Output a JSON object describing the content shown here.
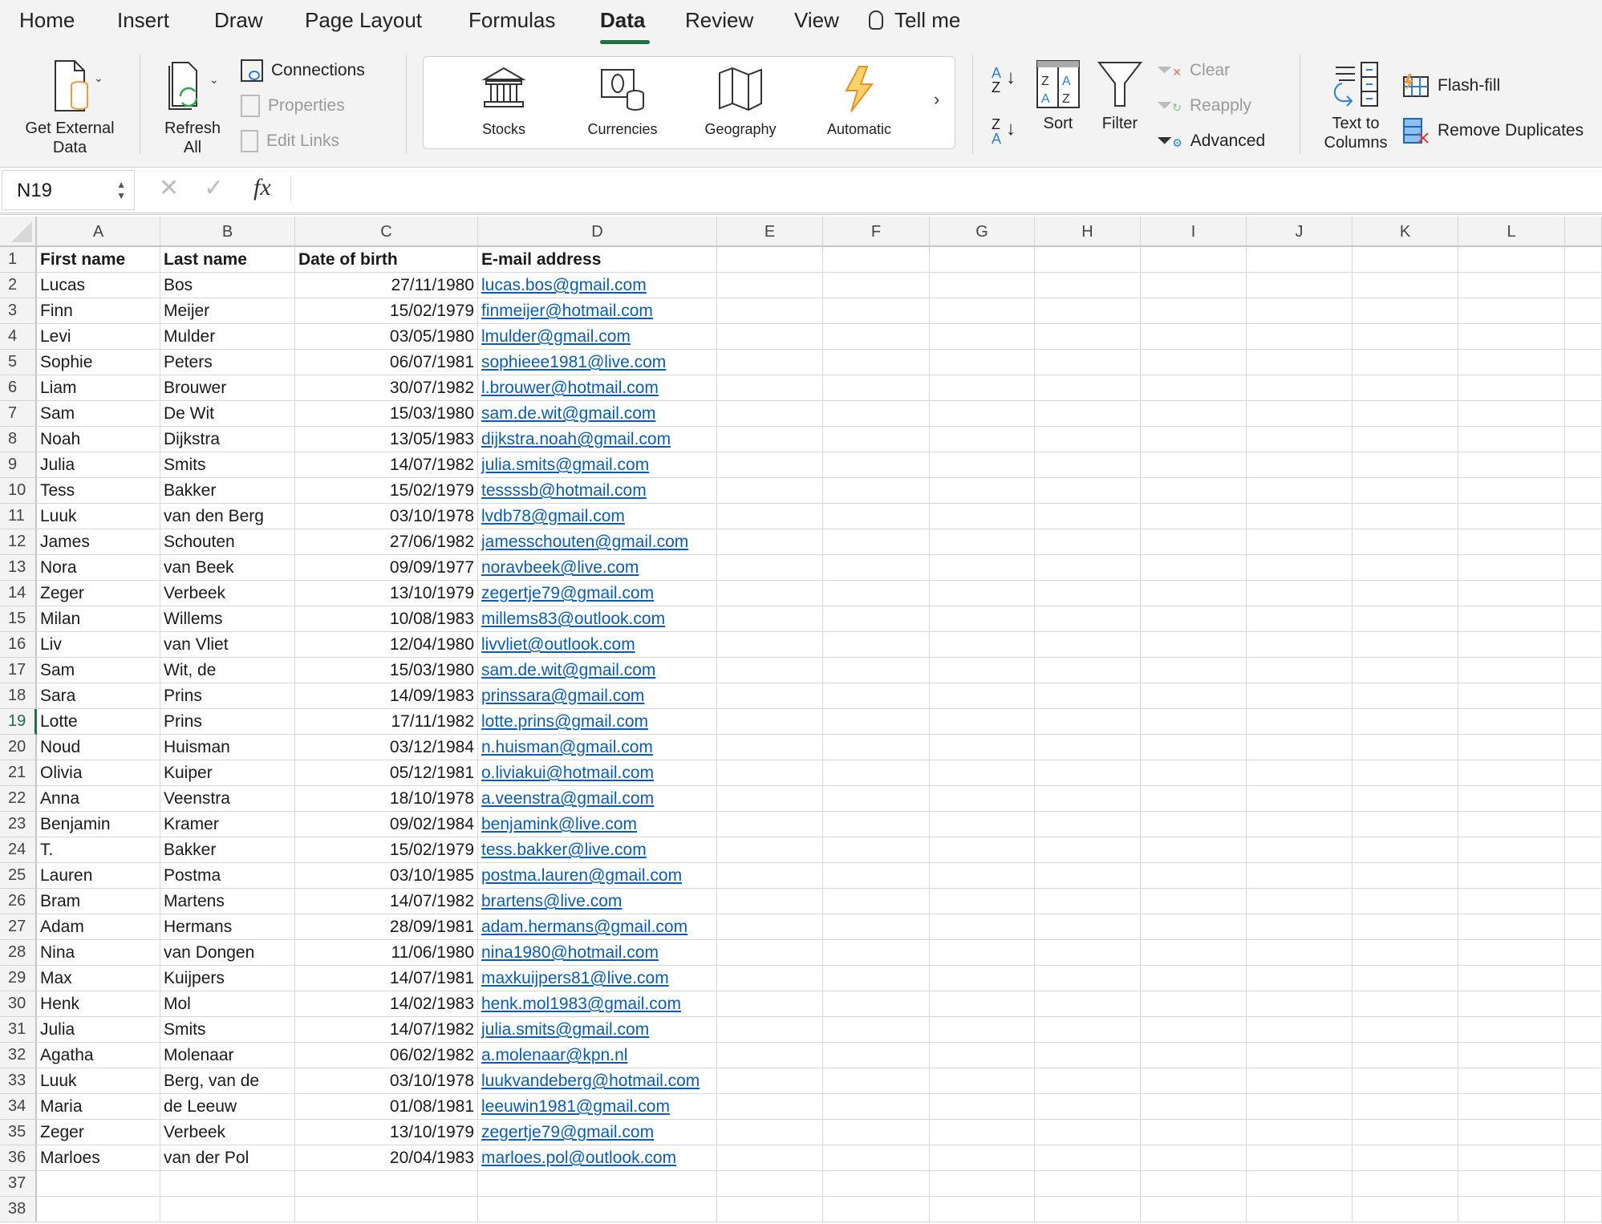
{
  "ribbon": {
    "tabs": [
      {
        "label": "Home",
        "active": false
      },
      {
        "label": "Insert",
        "active": false
      },
      {
        "label": "Draw",
        "active": false
      },
      {
        "label": "Page Layout",
        "active": false
      },
      {
        "label": "Formulas",
        "active": false
      },
      {
        "label": "Data",
        "active": true
      },
      {
        "label": "Review",
        "active": false
      },
      {
        "label": "View",
        "active": false
      },
      {
        "label": "Tell me",
        "active": false
      }
    ],
    "get_external_data": "Get External Data",
    "get_external_data_l1": "Get External",
    "get_external_data_l2": "Data",
    "refresh_l1": "Refresh",
    "refresh_l2": "All",
    "connections": "Connections",
    "properties": "Properties",
    "edit_links": "Edit Links",
    "data_types": [
      "Stocks",
      "Currencies",
      "Geography",
      "Automatic"
    ],
    "sort": "Sort",
    "filter": "Filter",
    "clear": "Clear",
    "reapply": "Reapply",
    "advanced": "Advanced",
    "text_to_columns_l1": "Text to",
    "text_to_columns_l2": "Columns",
    "flash_fill": "Flash-fill",
    "remove_duplicates": "Remove Duplicates"
  },
  "formula_bar": {
    "name_box": "N19",
    "cancel_icon": "✕",
    "enter_icon": "✓",
    "fx_label": "fx",
    "formula_value": ""
  },
  "sheet": {
    "columns": [
      "A",
      "B",
      "C",
      "D",
      "E",
      "F",
      "G",
      "H",
      "I",
      "J",
      "K",
      "L"
    ],
    "selected_row": 19,
    "row_numbers": [
      1,
      2,
      3,
      4,
      5,
      6,
      7,
      8,
      9,
      10,
      11,
      12,
      13,
      14,
      15,
      16,
      17,
      18,
      19,
      20,
      21,
      22,
      23,
      24,
      25,
      26,
      27,
      28,
      29,
      30,
      31,
      32,
      33,
      34,
      35,
      36,
      37,
      38
    ],
    "headers": [
      "First name",
      "Last name",
      "Date of birth",
      "E-mail address"
    ],
    "rows": [
      [
        "Lucas",
        "Bos",
        "27/11/1980",
        "lucas.bos@gmail.com"
      ],
      [
        "Finn",
        "Meijer",
        "15/02/1979",
        "finmeijer@hotmail.com"
      ],
      [
        "Levi",
        "Mulder",
        "03/05/1980",
        "lmulder@gmail.com"
      ],
      [
        "Sophie",
        "Peters",
        "06/07/1981",
        "sophieee1981@live.com"
      ],
      [
        "Liam",
        "Brouwer",
        "30/07/1982",
        "l.brouwer@hotmail.com"
      ],
      [
        "Sam",
        "De Wit",
        "15/03/1980",
        "sam.de.wit@gmail.com"
      ],
      [
        "Noah",
        "Dijkstra",
        "13/05/1983",
        "dijkstra.noah@gmail.com"
      ],
      [
        "Julia",
        "Smits",
        "14/07/1982",
        "julia.smits@gmail.com"
      ],
      [
        "Tess",
        "Bakker",
        "15/02/1979",
        "tessssb@hotmail.com"
      ],
      [
        "Luuk",
        "van den Berg",
        "03/10/1978",
        "lvdb78@gmail.com"
      ],
      [
        "James",
        "Schouten",
        "27/06/1982",
        "jamesschouten@gmail.com"
      ],
      [
        "Nora",
        "van Beek",
        "09/09/1977",
        "noravbeek@live.com"
      ],
      [
        "Zeger",
        "Verbeek",
        "13/10/1979",
        "zegertje79@gmail.com"
      ],
      [
        "Milan",
        "Willems",
        "10/08/1983",
        "millems83@outlook.com"
      ],
      [
        "Liv",
        "van Vliet",
        "12/04/1980",
        "livvliet@outlook.com"
      ],
      [
        "Sam",
        "Wit, de",
        "15/03/1980",
        "sam.de.wit@gmail.com"
      ],
      [
        "Sara",
        "Prins",
        "14/09/1983",
        "prinssara@gmail.com"
      ],
      [
        "Lotte",
        "Prins",
        "17/11/1982",
        "lotte.prins@gmail.com"
      ],
      [
        "Noud",
        "Huisman",
        "03/12/1984",
        "n.huisman@gmail.com"
      ],
      [
        "Olivia",
        "Kuiper",
        "05/12/1981",
        "o.liviakui@hotmail.com"
      ],
      [
        "Anna",
        "Veenstra",
        "18/10/1978",
        "a.veenstra@gmail.com"
      ],
      [
        "Benjamin",
        "Kramer",
        "09/02/1984",
        "benjamink@live.com"
      ],
      [
        "T.",
        "Bakker",
        "15/02/1979",
        "tess.bakker@live.com"
      ],
      [
        "Lauren",
        "Postma",
        "03/10/1985",
        "postma.lauren@gmail.com"
      ],
      [
        "Bram",
        "Martens",
        "14/07/1982",
        "brartens@live.com"
      ],
      [
        "Adam",
        "Hermans",
        "28/09/1981",
        "adam.hermans@gmail.com"
      ],
      [
        "Nina",
        "van Dongen",
        "11/06/1980",
        "nina1980@hotmail.com"
      ],
      [
        "Max",
        "Kuijpers",
        "14/07/1981",
        "maxkuijpers81@live.com"
      ],
      [
        "Henk",
        "Mol",
        "14/02/1983",
        "henk.mol1983@gmail.com"
      ],
      [
        "Julia",
        "Smits",
        "14/07/1982",
        "julia.smits@gmail.com"
      ],
      [
        "Agatha",
        "Molenaar",
        "06/02/1982",
        "a.molenaar@kpn.nl"
      ],
      [
        "Luuk",
        "Berg, van de",
        "03/10/1978",
        "luukvandeberg@hotmail.com"
      ],
      [
        "Maria",
        "de Leeuw",
        "01/08/1981",
        "leeuwin1981@gmail.com"
      ],
      [
        "Zeger",
        "Verbeek",
        "13/10/1979",
        "zegertje79@gmail.com"
      ],
      [
        "Marloes",
        "van der Pol",
        "20/04/1983",
        "marloes.pol@outlook.com"
      ]
    ]
  },
  "colors": {
    "accent": "#1e7145",
    "link": "#0b5cad",
    "ribbon_bg": "#f3f3f3",
    "gridline": "#d8d8d8"
  }
}
